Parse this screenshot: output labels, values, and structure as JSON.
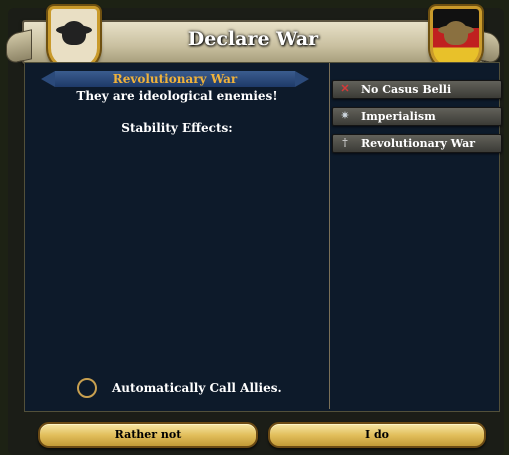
{
  "dialog": {
    "title": "Declare War"
  },
  "war": {
    "casus_belli_name": "Revolutionary War",
    "reason": "They are ideological enemies!",
    "stability_label": "Stability Effects:"
  },
  "allies": {
    "label": "Automatically Call Allies."
  },
  "cb_options": [
    {
      "label": "No Casus Belli",
      "icon": "x-icon"
    },
    {
      "label": "Imperialism",
      "icon": "globe-icon"
    },
    {
      "label": "Revolutionary War",
      "icon": "sword-icon"
    }
  ],
  "buttons": {
    "reject": "Rather not",
    "accept": "I do"
  }
}
